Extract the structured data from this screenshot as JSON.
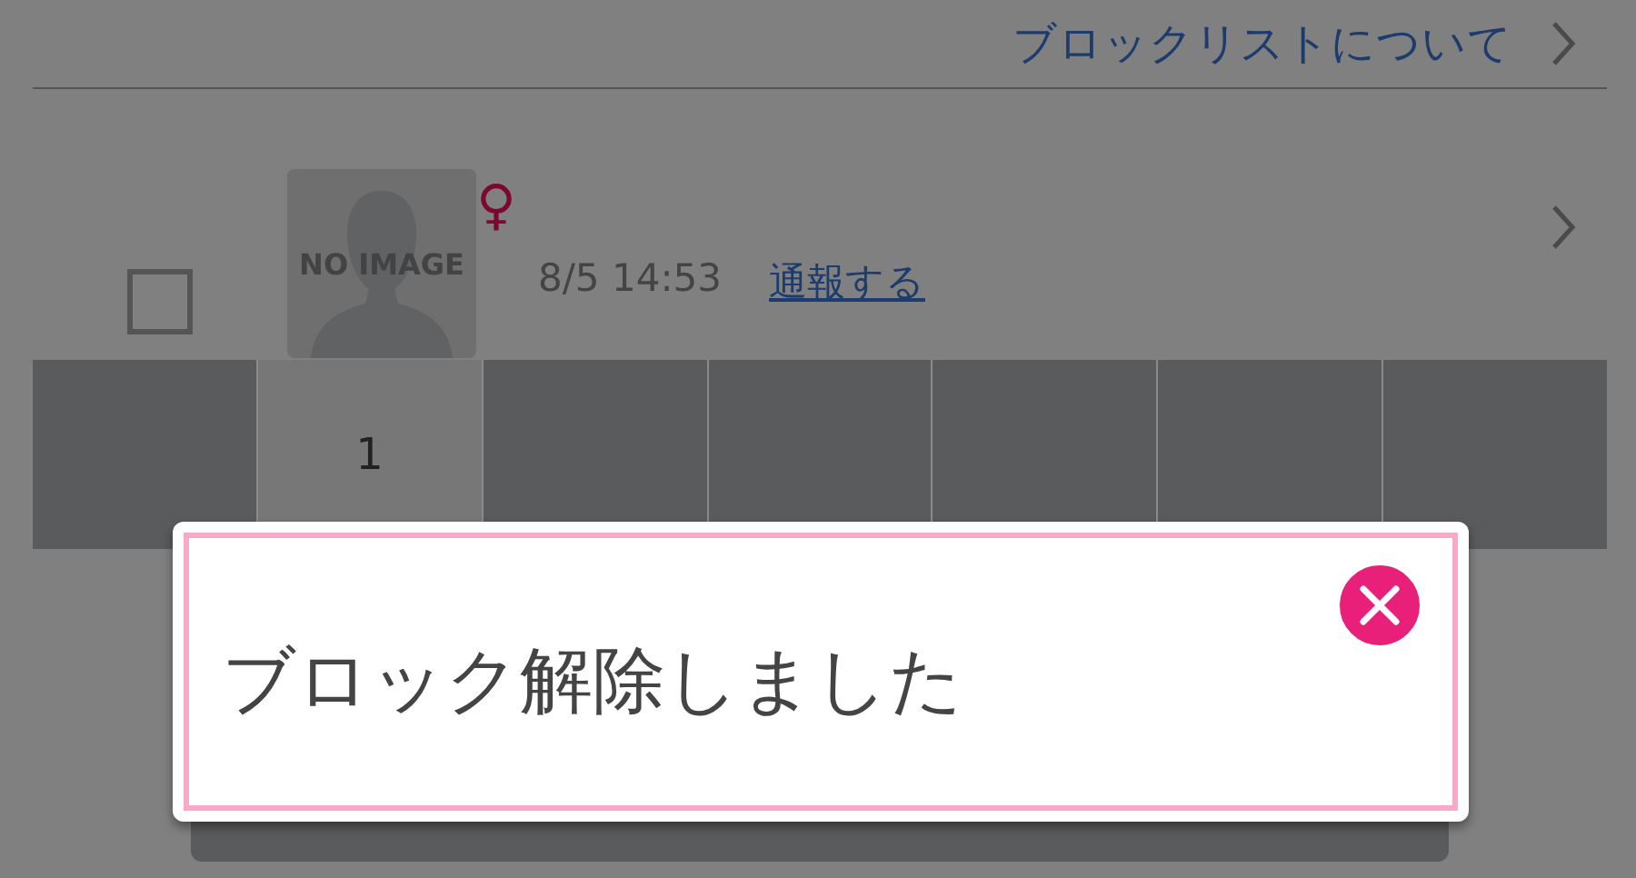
{
  "header": {
    "link": "ブロックリストについて"
  },
  "blocked_users": [
    {
      "avatar_text": "NO IMAGE",
      "gender_symbol": "♀",
      "checked": false,
      "time": "8/5 14:53",
      "report_link": "通報する"
    }
  ],
  "pagination": [
    {
      "selected": false
    },
    {
      "label": "1",
      "selected": true
    },
    {
      "selected": false
    },
    {
      "selected": false
    },
    {
      "selected": false
    },
    {
      "selected": false
    },
    {
      "selected": false
    }
  ],
  "dialog": {
    "message": "ブロック解除しました"
  }
}
